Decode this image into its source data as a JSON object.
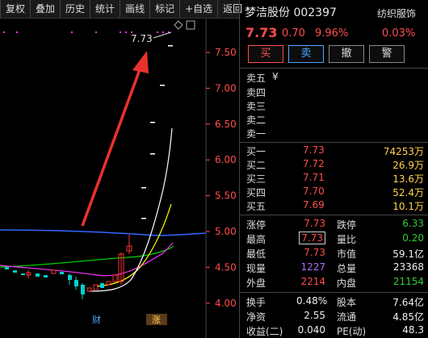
{
  "toolbar": {
    "items": [
      "复权",
      "叠加",
      "历史",
      "统计",
      "画线",
      "标记",
      "+自选",
      "返回"
    ]
  },
  "chart": {
    "price_ticks": [
      "7.50",
      "7.00",
      "6.50",
      "6.00",
      "5.50",
      "5.00",
      "4.50",
      "4.00"
    ],
    "peak_label": "7.73",
    "markers": [
      "财",
      "涨"
    ],
    "colors": {
      "up": "#ff3333",
      "down": "#00d0d0",
      "ma1": "#ffffff",
      "ma2": "#ffff00",
      "ma3": "#ff33ff",
      "ma4": "#00cc00",
      "ma5": "#3366ff",
      "arrow": "#e8322d"
    }
  },
  "stock": {
    "name_code": "梦洁股份 002397",
    "sector": "纺织服饰",
    "price": "7.73",
    "change": "0.70",
    "change_pct": "9.96%",
    "sector_pct": "0.03%"
  },
  "buttons": [
    "买",
    "卖",
    "撤",
    "警"
  ],
  "order_book": {
    "sells": [
      {
        "label": "卖五",
        "extra": "¥",
        "price": "",
        "vol": ""
      },
      {
        "label": "卖四",
        "extra": "",
        "price": "",
        "vol": ""
      },
      {
        "label": "卖三",
        "extra": "",
        "price": "",
        "vol": ""
      },
      {
        "label": "卖二",
        "extra": "",
        "price": "",
        "vol": ""
      },
      {
        "label": "卖一",
        "extra": "",
        "price": "",
        "vol": ""
      }
    ],
    "buys": [
      {
        "label": "买一",
        "price": "7.73",
        "vol": "74253万"
      },
      {
        "label": "买二",
        "price": "7.72",
        "vol": "26.9万"
      },
      {
        "label": "买三",
        "price": "7.71",
        "vol": "13.6万"
      },
      {
        "label": "买四",
        "price": "7.70",
        "vol": "52.4万"
      },
      {
        "label": "买五",
        "price": "7.69",
        "vol": "10.1万"
      }
    ]
  },
  "stats1": [
    {
      "l1": "涨停",
      "v1": "7.73",
      "c1": "red",
      "l2": "跌停",
      "v2": "6.33",
      "c2": "green"
    },
    {
      "l1": "最高",
      "v1": "7.73",
      "c1": "red",
      "l2": "量比",
      "v2": "0.20",
      "c2": "green"
    },
    {
      "l1": "最低",
      "v1": "7.73",
      "c1": "red",
      "l2": "市值",
      "v2": "59.1亿",
      "c2": "white"
    },
    {
      "l1": "现量",
      "v1": "1227",
      "c1": "purple",
      "l2": "总量",
      "v2": "23368",
      "c2": "white"
    },
    {
      "l1": "外盘",
      "v1": "2214",
      "c1": "red",
      "l2": "内盘",
      "v2": "21154",
      "c2": "green"
    }
  ],
  "stats2": [
    {
      "l1": "换手",
      "v1": "0.48%",
      "c1": "white",
      "l2": "股本",
      "v2": "7.64亿",
      "c2": "white"
    },
    {
      "l1": "净资",
      "v1": "2.55",
      "c1": "white",
      "l2": "流通",
      "v2": "4.85亿",
      "c2": "white"
    },
    {
      "l1": "收益(二)",
      "v1": "0.040",
      "c1": "white",
      "l2": "PE(动)",
      "v2": "48.3",
      "c2": "white"
    }
  ]
}
